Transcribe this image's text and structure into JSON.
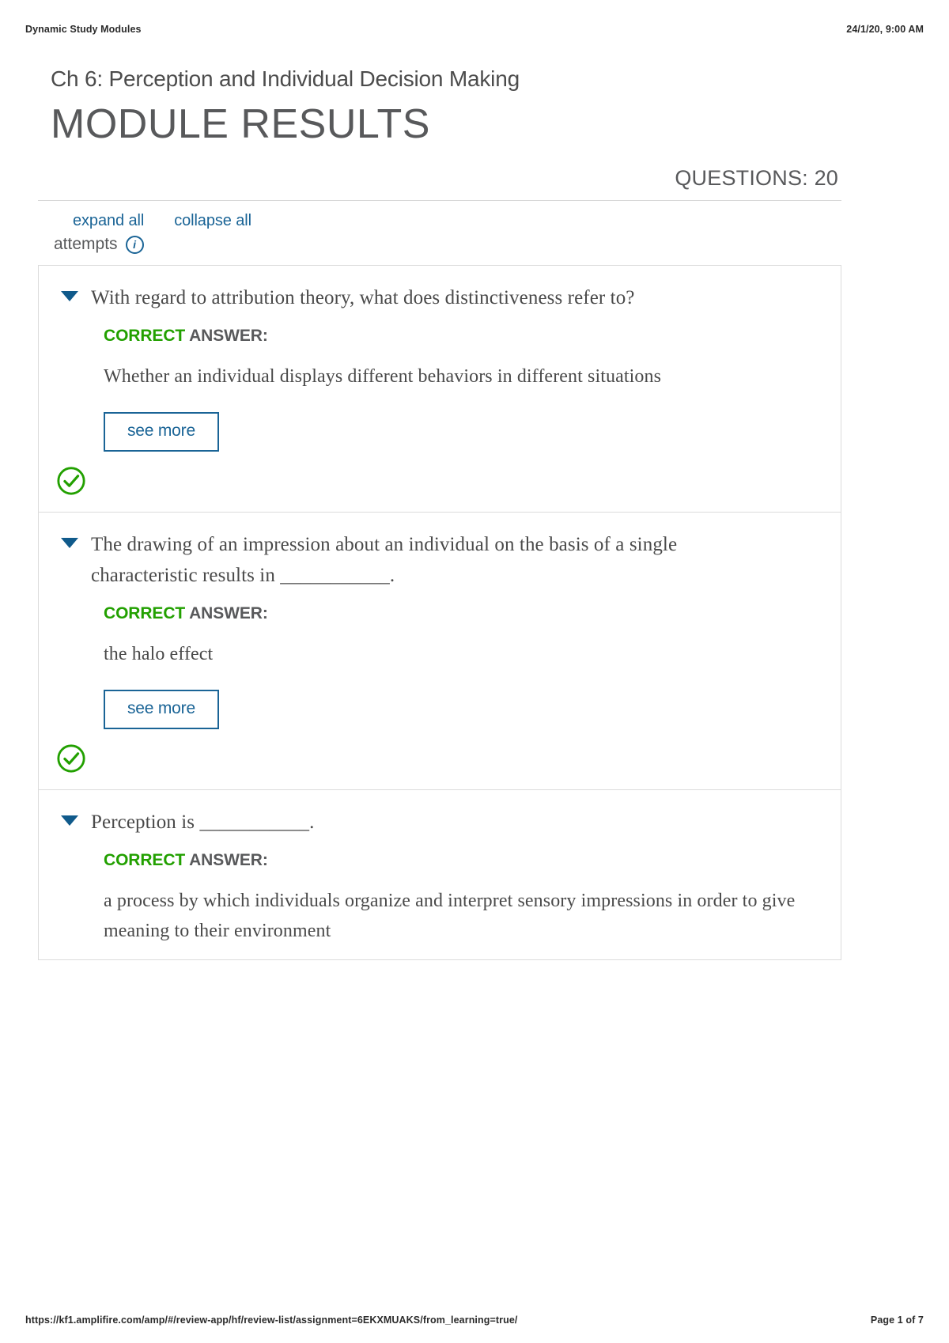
{
  "print_header": {
    "title": "Dynamic Study Modules",
    "timestamp": "24/1/20, 9:00 AM"
  },
  "page": {
    "chapter_title": "Ch 6: Perception and Individual Decision Making",
    "module_results_heading": "MODULE RESULTS",
    "questions_count_label": "QUESTIONS: 20"
  },
  "controls": {
    "expand_all": "expand all",
    "collapse_all": "collapse all",
    "attempts_label": "attempts",
    "info_icon_glyph": "i",
    "link_color": "#1a6496"
  },
  "answer_label": {
    "correct_word": "CORRECT",
    "answer_word": "ANSWER:",
    "correct_color": "#22a000"
  },
  "buttons": {
    "see_more": "see more"
  },
  "questions": [
    {
      "question": "With regard to attribution theory, what does distinctiveness refer to?",
      "answer": "Whether an individual displays different behaviors in different situations",
      "status": "correct"
    },
    {
      "question": "The drawing of an impression about an individual on the basis of a single characteristic results in ___________.",
      "answer": "the halo effect",
      "status": "correct"
    },
    {
      "question": "Perception is ___________.",
      "answer": "a process by which individuals organize and interpret sensory impressions in order to give meaning to their environment",
      "status": "none"
    }
  ],
  "print_footer": {
    "url": "https://kf1.amplifire.com/amp/#/review-app/hf/review-list/assignment=6EKXMUAKS/from_learning=true/",
    "page_number": "Page 1 of 7"
  }
}
